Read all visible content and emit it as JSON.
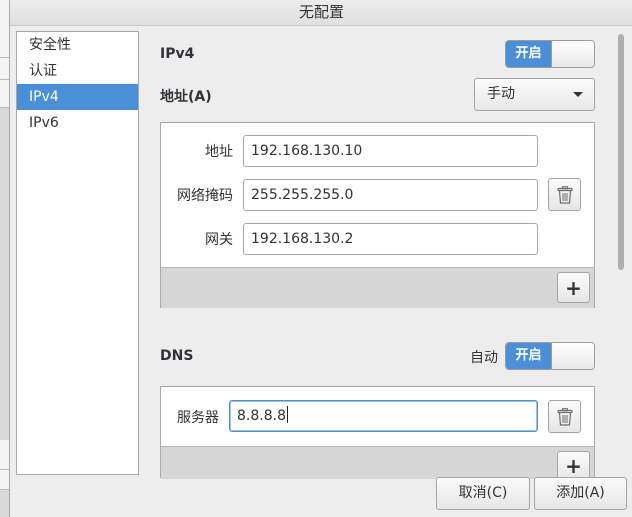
{
  "window": {
    "title": "无配置"
  },
  "sidebar": {
    "items": [
      {
        "label": "安全性"
      },
      {
        "label": "认证"
      },
      {
        "label": "IPv4"
      },
      {
        "label": "IPv6"
      }
    ],
    "selected_index": 2
  },
  "ipv4": {
    "heading": "IPv4",
    "toggle_label": "开启",
    "address_section_label": "地址(A)",
    "method": "手动",
    "address_label": "地址",
    "address_value": "192.168.130.10",
    "netmask_label": "网络掩码",
    "netmask_value": "255.255.255.0",
    "gateway_label": "网关",
    "gateway_value": "192.168.130.2",
    "add_symbol": "+"
  },
  "dns": {
    "heading": "DNS",
    "auto_label": "自动",
    "toggle_label": "开启",
    "server_label": "服务器",
    "server_value": "8.8.8.8",
    "add_symbol": "+"
  },
  "footer": {
    "cancel_label": "取消(C)",
    "add_label": "添加(A)"
  },
  "colors": {
    "accent": "#4a90d9",
    "selection_text": "#ffffff"
  },
  "icons": {
    "delete": "trash-icon",
    "dropdown": "chevron-down-icon",
    "add": "plus-icon"
  }
}
